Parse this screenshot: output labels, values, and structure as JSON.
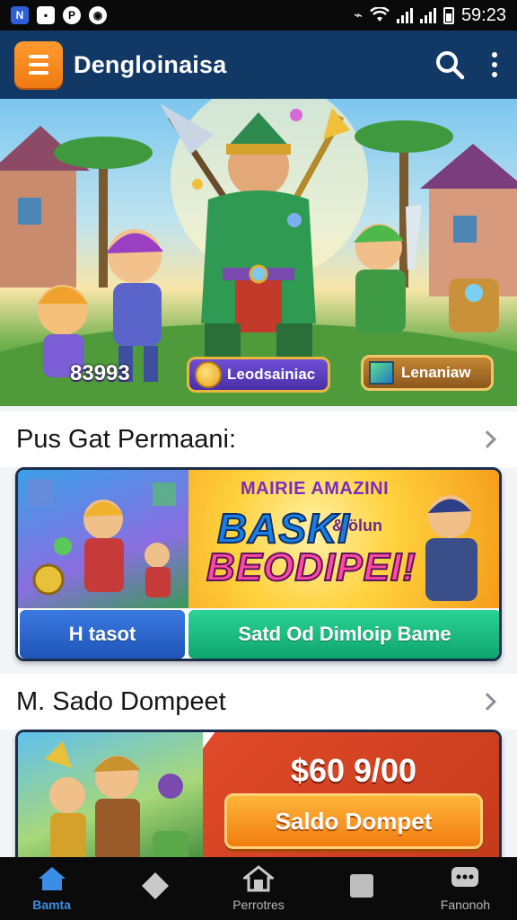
{
  "status_bar": {
    "time": "59:23",
    "left_icons": [
      "notification-icon",
      "photo-icon",
      "play-icon",
      "camera-icon"
    ],
    "right_icons": [
      "vibrate-icon",
      "wifi-icon",
      "signal-icon",
      "battery-icon"
    ]
  },
  "app_bar": {
    "title": "Dengloinaisa",
    "menu_icon": "menu-icon",
    "search_icon": "search-icon",
    "more_icon": "more-vert-icon",
    "accent_color": "#f38a1e",
    "background_color": "#123866"
  },
  "hero": {
    "player_score": "83993",
    "coin_badge_label": "Leodsainiac",
    "gem_badge_label": "Lenaniaw"
  },
  "games_section": {
    "title": "Pus Gat Permaani:",
    "promo": {
      "kicker": "MAIRIE AMAZINI",
      "headline_1": "BASKI",
      "headline_1_small": "& ölun",
      "headline_2": "BEODIPEI!",
      "left_button": "H tasot",
      "right_button": "Satd Od Dimloip Bame"
    }
  },
  "wallet_section": {
    "title": "M. Sado Dompeet",
    "amount": "$60 9/00",
    "button": "Saldo Dompet"
  },
  "bottom_nav": {
    "items": [
      {
        "label": "Bamta",
        "icon": "home-icon",
        "active": true
      },
      {
        "label": "",
        "icon": "diamond-icon",
        "active": false
      },
      {
        "label": "Perrotres",
        "icon": "store-icon",
        "active": false
      },
      {
        "label": "",
        "icon": "square-icon",
        "active": false
      },
      {
        "label": "Fanonoh",
        "icon": "chat-icon",
        "active": false
      }
    ]
  }
}
